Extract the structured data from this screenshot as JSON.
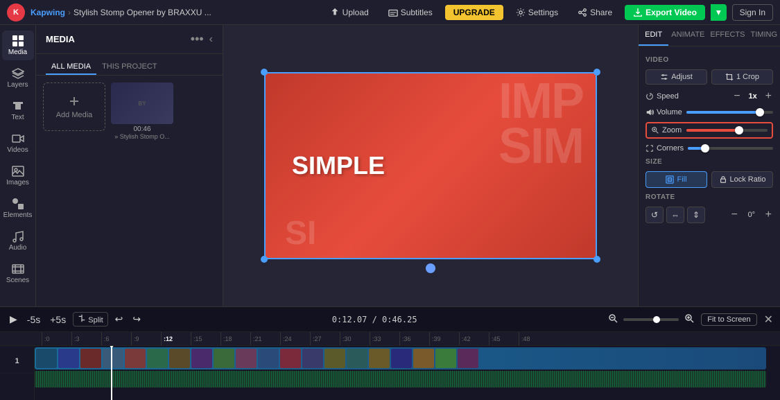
{
  "topbar": {
    "brand": "Kapwing",
    "separator": "›",
    "title": "Stylish Stomp Opener by BRAXXU ...",
    "upload_label": "Upload",
    "subtitles_label": "Subtitles",
    "upgrade_label": "UPGRADE",
    "settings_label": "Settings",
    "share_label": "Share",
    "export_label": "Export Video",
    "signin_label": "Sign In"
  },
  "sidebar": {
    "items": [
      {
        "id": "media",
        "label": "Media",
        "icon": "grid"
      },
      {
        "id": "layers",
        "label": "Layers",
        "icon": "layers"
      },
      {
        "id": "text",
        "label": "Text",
        "icon": "text"
      },
      {
        "id": "videos",
        "label": "Videos",
        "icon": "video"
      },
      {
        "id": "images",
        "label": "Images",
        "icon": "image"
      },
      {
        "id": "elements",
        "label": "Elements",
        "icon": "shapes"
      },
      {
        "id": "audio",
        "label": "Audio",
        "icon": "music"
      },
      {
        "id": "scenes",
        "label": "Scenes",
        "icon": "film"
      }
    ]
  },
  "media_panel": {
    "title": "MEDIA",
    "tabs": [
      "ALL MEDIA",
      "THIS PROJECT"
    ],
    "active_tab": 0,
    "add_media_label": "Add Media",
    "media_items": [
      {
        "duration": "00:46",
        "name": "» Stylish Stomp O..."
      }
    ]
  },
  "right_panel": {
    "tabs": [
      "EDIT",
      "ANIMATE",
      "EFFECTS",
      "TIMING"
    ],
    "active_tab": "EDIT",
    "sections": {
      "video_label": "VIDEO",
      "adjust_label": "Adjust",
      "crop_label": "1 Crop",
      "speed_label": "Speed",
      "speed_value": "1x",
      "volume_label": "Volume",
      "volume_pct": 85,
      "zoom_label": "Zoom",
      "zoom_pct": 65,
      "corners_label": "Corners",
      "corners_pct": 20,
      "size_label": "SIZE",
      "fill_label": "Fill",
      "lock_ratio_label": "Lock Ratio",
      "rotate_label": "ROTATE",
      "rotate_value": "0°"
    }
  },
  "canvas": {
    "text_imp": "IMP",
    "text_sim": "SIM",
    "text_simple": "SIMPLE",
    "text_si": "SI"
  },
  "timeline": {
    "play_label": "▶",
    "rewind_label": "-5s",
    "forward_label": "+5s",
    "split_label": "Split",
    "timecode": "0:12.07 / 0:46.25",
    "fit_label": "Fit to Screen",
    "ruler_marks": [
      ":0",
      ":3",
      ":6",
      ":9",
      ":12",
      ":15",
      ":18",
      ":21",
      ":24",
      ":27",
      ":30",
      ":33",
      ":36",
      ":39",
      ":42",
      ":45",
      ":48"
    ]
  }
}
